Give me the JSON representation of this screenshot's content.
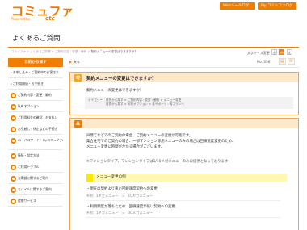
{
  "header": {
    "logo_text": "コミュファ",
    "logo_sub": "Powered by",
    "logo_brand": "ctc",
    "btn_web_mail": "Webメールログイン",
    "btn_my_commufa": "My コミュファログイン"
  },
  "page": {
    "title": "よくあるご質問"
  },
  "breadcrumb": {
    "items": [
      "コミュファ",
      "よくあるご質問",
      "ご契約内容・変更・解約"
    ],
    "current": "契約メニューの変更はできますか？"
  },
  "tools": {
    "print_label": "文字サイズ変更",
    "sizes": [
      "小",
      "中",
      "大"
    ]
  },
  "sidebar": {
    "heading": "目的から探す",
    "items": [
      {
        "label": "お申し込み・ご契約中のお客さま",
        "icon": "bullet",
        "tall": false
      },
      {
        "label": "ご利用開始・お手続き",
        "icon": "bullet",
        "tall": false
      },
      {
        "label": "ご契約内容・変更・解約",
        "icon": "document-icon",
        "tall": false
      },
      {
        "label": "私有オプション",
        "icon": "option-icon",
        "tall": false
      },
      {
        "label": "ご利用料金の確認・お支払い",
        "icon": "yen-icon",
        "tall": false
      },
      {
        "label": "お引越し・休止などの手続き",
        "icon": "home-icon",
        "tall": false
      },
      {
        "label": "ID・パスワード・MyコミュファID確認",
        "icon": "key-icon",
        "tall": true
      },
      {
        "label": "接続・設定方法",
        "icon": "connect-icon",
        "tall": false
      },
      {
        "label": "ご利用トラブル",
        "icon": "trouble-icon",
        "tall": false
      },
      {
        "label": "光電話に関するご案内",
        "icon": "phone-icon",
        "tall": false
      },
      {
        "label": "モバイルに関するご案内",
        "icon": "mobile-icon",
        "tall": false
      },
      {
        "label": "提携サービス",
        "icon": "service-icon",
        "tall": false
      }
    ]
  },
  "main": {
    "back_label": "戻る",
    "faq_number": "No. 336",
    "question": {
      "badge": "Q",
      "title": "契約メニューの変更はできますか？",
      "text": "契約メニューの変更はできますか？",
      "category_label": "カテゴリー",
      "category_line1": "目的から探す > ご契約内容・変更・解約 > メニュー変更",
      "category_line2": "目的から探す > 私有オプション > 各サポート・各プランへ"
    },
    "answer": {
      "badge": "A",
      "body_lines": [
        "戸建てなどでのご契約の場合、ご契約メニューの変更が可能です。",
        "集合住宅でのご契約の場合、一部マンション専用メニューのみの場合は回線速度変更のため、",
        "メニュー変更に時間がかかる場合がございます。"
      ],
      "note": "※マンションタイプ、マンションタイプは1/10メガメニューのみの提供となっております",
      "example_title": "メニュー変更の例",
      "examples": [
        {
          "title": "・現在の契約より速い回線速度契約への変更",
          "detail": "※例：1ギガメニュー　⇒　10ギガメニュー"
        },
        {
          "title": "・利用頻度が落ちたため、回線速度が低い契約への変更",
          "detail": "※例：1ギガメニュー　⇒　30メガメニュー"
        }
      ]
    }
  }
}
